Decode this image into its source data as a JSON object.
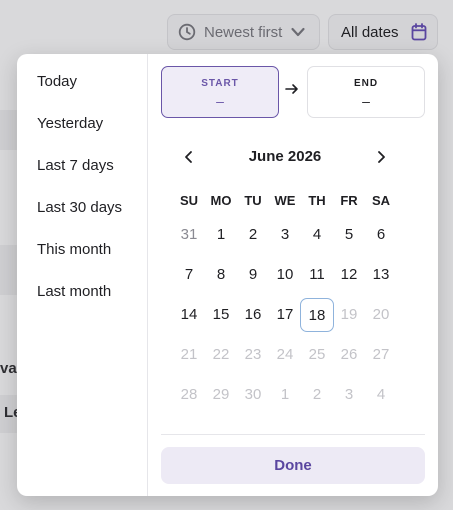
{
  "toolbar": {
    "sort_label": "Newest first",
    "date_filter_label": "All dates"
  },
  "background": {
    "fragment_1": "va",
    "fragment_2": "Le"
  },
  "presets": [
    "Today",
    "Yesterday",
    "Last 7 days",
    "Last 30 days",
    "This month",
    "Last month"
  ],
  "range": {
    "start_label": "START",
    "start_value": "–",
    "end_label": "END",
    "end_value": "–"
  },
  "calendar": {
    "month_title": "June 2026",
    "weekdays": [
      "SU",
      "MO",
      "TU",
      "WE",
      "TH",
      "FR",
      "SA"
    ],
    "today": "18",
    "weeks": [
      [
        {
          "d": "31",
          "s": "other"
        },
        {
          "d": "1",
          "s": "current"
        },
        {
          "d": "2",
          "s": "current"
        },
        {
          "d": "3",
          "s": "current"
        },
        {
          "d": "4",
          "s": "current"
        },
        {
          "d": "5",
          "s": "current"
        },
        {
          "d": "6",
          "s": "current"
        }
      ],
      [
        {
          "d": "7",
          "s": "current"
        },
        {
          "d": "8",
          "s": "current"
        },
        {
          "d": "9",
          "s": "current"
        },
        {
          "d": "10",
          "s": "current"
        },
        {
          "d": "11",
          "s": "current"
        },
        {
          "d": "12",
          "s": "current"
        },
        {
          "d": "13",
          "s": "current"
        }
      ],
      [
        {
          "d": "14",
          "s": "current"
        },
        {
          "d": "15",
          "s": "current"
        },
        {
          "d": "16",
          "s": "current"
        },
        {
          "d": "17",
          "s": "current"
        },
        {
          "d": "18",
          "s": "today"
        },
        {
          "d": "19",
          "s": "muted"
        },
        {
          "d": "20",
          "s": "muted"
        }
      ],
      [
        {
          "d": "21",
          "s": "muted"
        },
        {
          "d": "22",
          "s": "muted"
        },
        {
          "d": "23",
          "s": "muted"
        },
        {
          "d": "24",
          "s": "muted"
        },
        {
          "d": "25",
          "s": "muted"
        },
        {
          "d": "26",
          "s": "muted"
        },
        {
          "d": "27",
          "s": "muted"
        }
      ],
      [
        {
          "d": "28",
          "s": "muted"
        },
        {
          "d": "29",
          "s": "muted"
        },
        {
          "d": "30",
          "s": "muted"
        },
        {
          "d": "1",
          "s": "muted"
        },
        {
          "d": "2",
          "s": "muted"
        },
        {
          "d": "3",
          "s": "muted"
        },
        {
          "d": "4",
          "s": "muted"
        }
      ]
    ]
  },
  "done_label": "Done",
  "icons": {
    "sort": "clock-icon",
    "sort_caret": "chevron-down-icon",
    "date": "calendar-icon",
    "prev": "chevron-left-icon",
    "next": "chevron-right-icon",
    "range_arrow": "arrow-right-icon"
  },
  "colors": {
    "accent": "#6a56a8",
    "accent_bg": "#efecf7",
    "today_border": "#8fb3dc",
    "muted_day": "#c3c3c8"
  }
}
